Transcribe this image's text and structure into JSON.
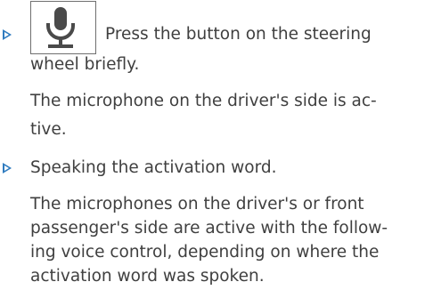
{
  "items": [
    {
      "icon": "microphone-icon",
      "line1": "Press the button on the steering",
      "line2": "wheel briefly.",
      "note_line1": "The microphone on the driver's side is ac-",
      "note_line2": "tive."
    },
    {
      "line1": "Speaking the activation word.",
      "note_line1": "The microphones on the driver's or front",
      "note_line2": "passenger's side are active with the follow-",
      "note_line3": "ing voice control, depending on where the",
      "note_line4": "activation word was spoken."
    }
  ],
  "colors": {
    "text": "#3f3f3f",
    "bullet": "#2f7bbf",
    "icon_border": "#6f6f6f"
  }
}
